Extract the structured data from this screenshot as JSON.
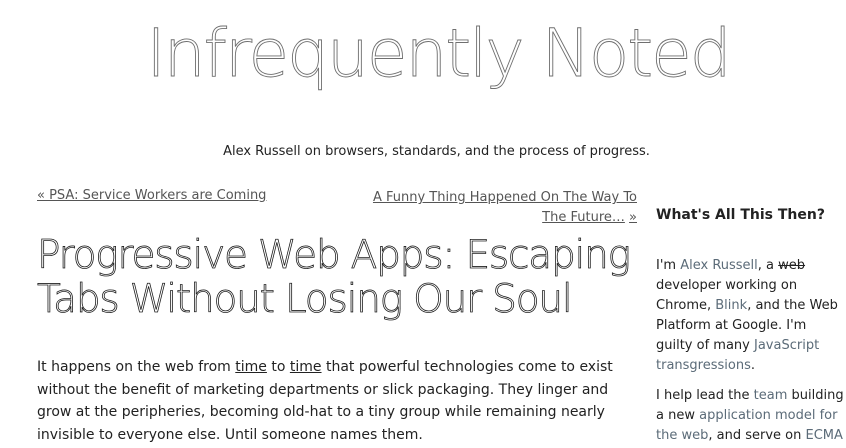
{
  "site": {
    "title": "Infrequently Noted",
    "tagline": "Alex Russell on browsers, standards, and the process of progress."
  },
  "nav": {
    "prev_label": "« PSA: Service Workers are Coming",
    "next_label": "A Funny Thing Happened On The Way To The Future…",
    "next_arrow": "»"
  },
  "post": {
    "title": "Progressive Web Apps: Escaping Tabs Without Losing Our Soul",
    "body": {
      "part1": "It happens on the web from ",
      "link1": "time",
      "part2": " to ",
      "link2": "time",
      "part3": " that powerful technologies come to exist without the benefit of marketing departments or slick packaging. They linger and grow at the peripheries, becoming old-hat to a tiny group while remaining nearly invisible to everyone else. Until someone names them."
    }
  },
  "sidebar": {
    "heading": "What's All This Then?",
    "about": {
      "t1": "I'm ",
      "name_link": "Alex Russell",
      "t2": ", a ",
      "struck": "web",
      "t3": " developer working on Chrome, ",
      "blink_link": "Blink",
      "t4": ", and the Web Platform at Google. I'm guilty of many ",
      "js_link": "JavaScript",
      "t5": " ",
      "transgressions_link": "transgressions",
      "t6": "."
    },
    "team": {
      "t1": "I help lead the ",
      "team_link": "team",
      "t2": " building a new ",
      "app_model_link": "application model for the web",
      "t3": ", and serve on ",
      "ecma_link": "ECMA"
    }
  }
}
